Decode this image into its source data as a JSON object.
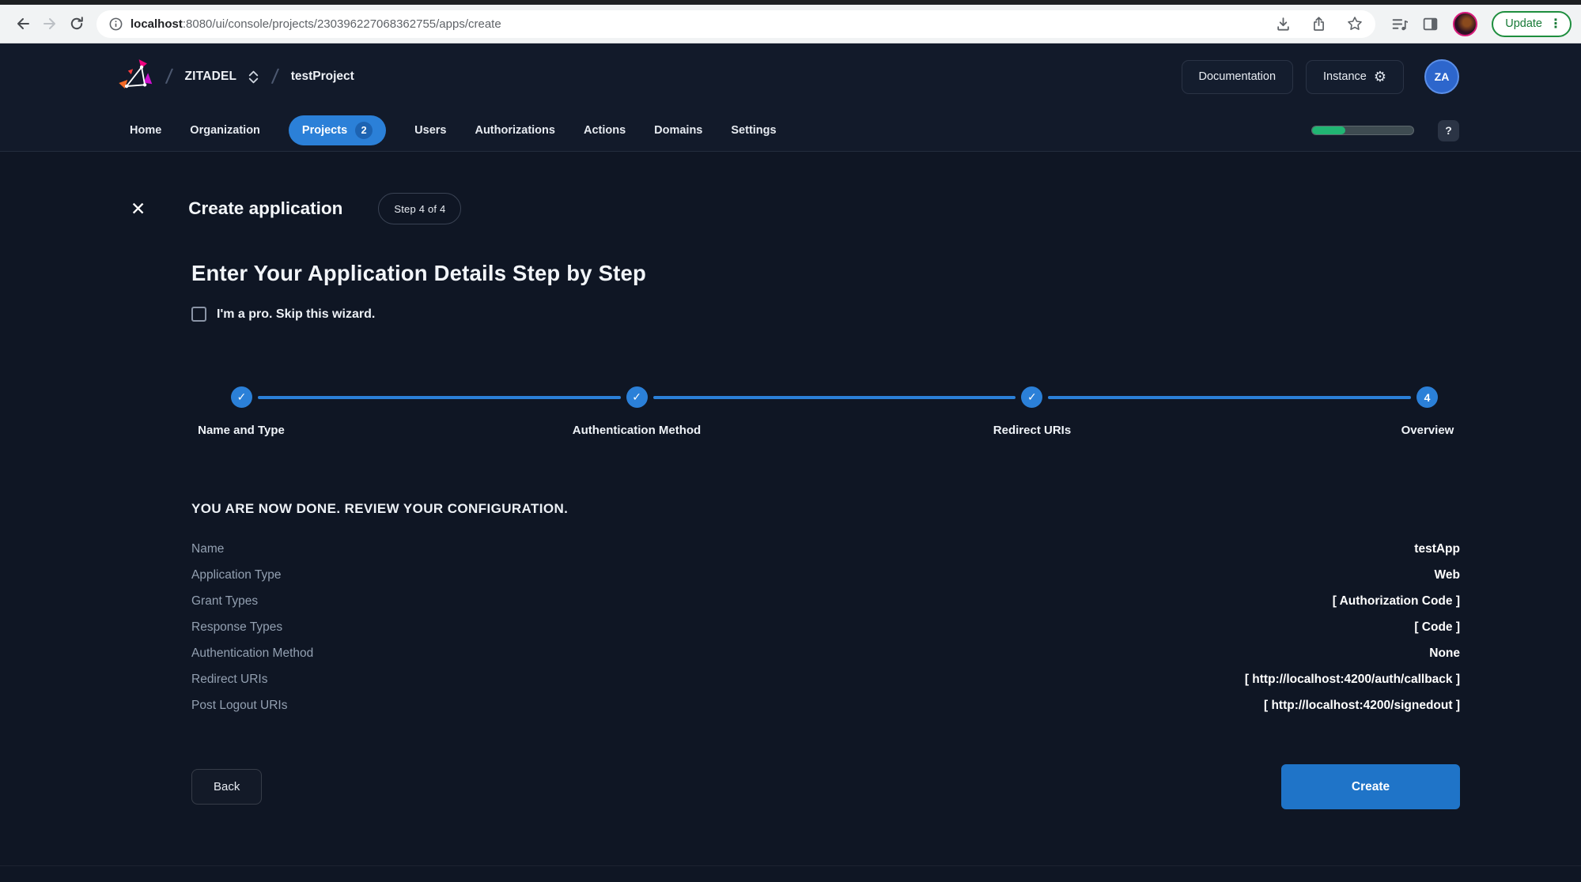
{
  "browser": {
    "url": {
      "host": "localhost",
      "rest": ":8080/ui/console/projects/230396227068362755/apps/create"
    },
    "update_label": "Update",
    "menu_dots": "⋮"
  },
  "header": {
    "org_name": "ZITADEL",
    "project_name": "testProject",
    "documentation_label": "Documentation",
    "instance_label": "Instance",
    "avatar_initials": "ZA",
    "help_label": "?",
    "progress_percent": 33,
    "tabs": [
      {
        "label": "Home"
      },
      {
        "label": "Organization"
      },
      {
        "label": "Projects",
        "badge": "2",
        "active": true
      },
      {
        "label": "Users"
      },
      {
        "label": "Authorizations"
      },
      {
        "label": "Actions"
      },
      {
        "label": "Domains"
      },
      {
        "label": "Settings"
      }
    ]
  },
  "wizard": {
    "title": "Create application",
    "step_badge": "Step 4 of 4",
    "heading": "Enter Your Application Details Step by Step",
    "skip_checkbox_label": "I'm a pro. Skip this wizard.",
    "skip_checkbox_checked": false,
    "steps": [
      {
        "label": "Name and Type",
        "state": "done"
      },
      {
        "label": "Authentication Method",
        "state": "done"
      },
      {
        "label": "Redirect URIs",
        "state": "done"
      },
      {
        "label": "Overview",
        "state": "current",
        "number": "4"
      }
    ],
    "review_heading": "YOU ARE NOW DONE. REVIEW YOUR CONFIGURATION.",
    "review_rows": [
      {
        "label": "Name",
        "value": "testApp"
      },
      {
        "label": "Application Type",
        "value": "Web"
      },
      {
        "label": "Grant Types",
        "value": "[ Authorization Code ]"
      },
      {
        "label": "Response Types",
        "value": "[ Code ]"
      },
      {
        "label": "Authentication Method",
        "value": "None"
      },
      {
        "label": "Redirect URIs",
        "value": "[ http://localhost:4200/auth/callback ]"
      },
      {
        "label": "Post Logout URIs",
        "value": "[ http://localhost:4200/signedout ]"
      }
    ],
    "back_label": "Back",
    "create_label": "Create"
  },
  "icons": {
    "close": "✕",
    "check": "✓",
    "gear": "⚙",
    "slash": "/"
  },
  "colors": {
    "accent": "#2b80d8",
    "accent_button": "#1f74c8",
    "badge_blue": "#1d63b2",
    "progress_green": "#21b573",
    "update_green": "#187a37",
    "header_bg": "#121a2a",
    "main_bg": "#0f1624"
  }
}
